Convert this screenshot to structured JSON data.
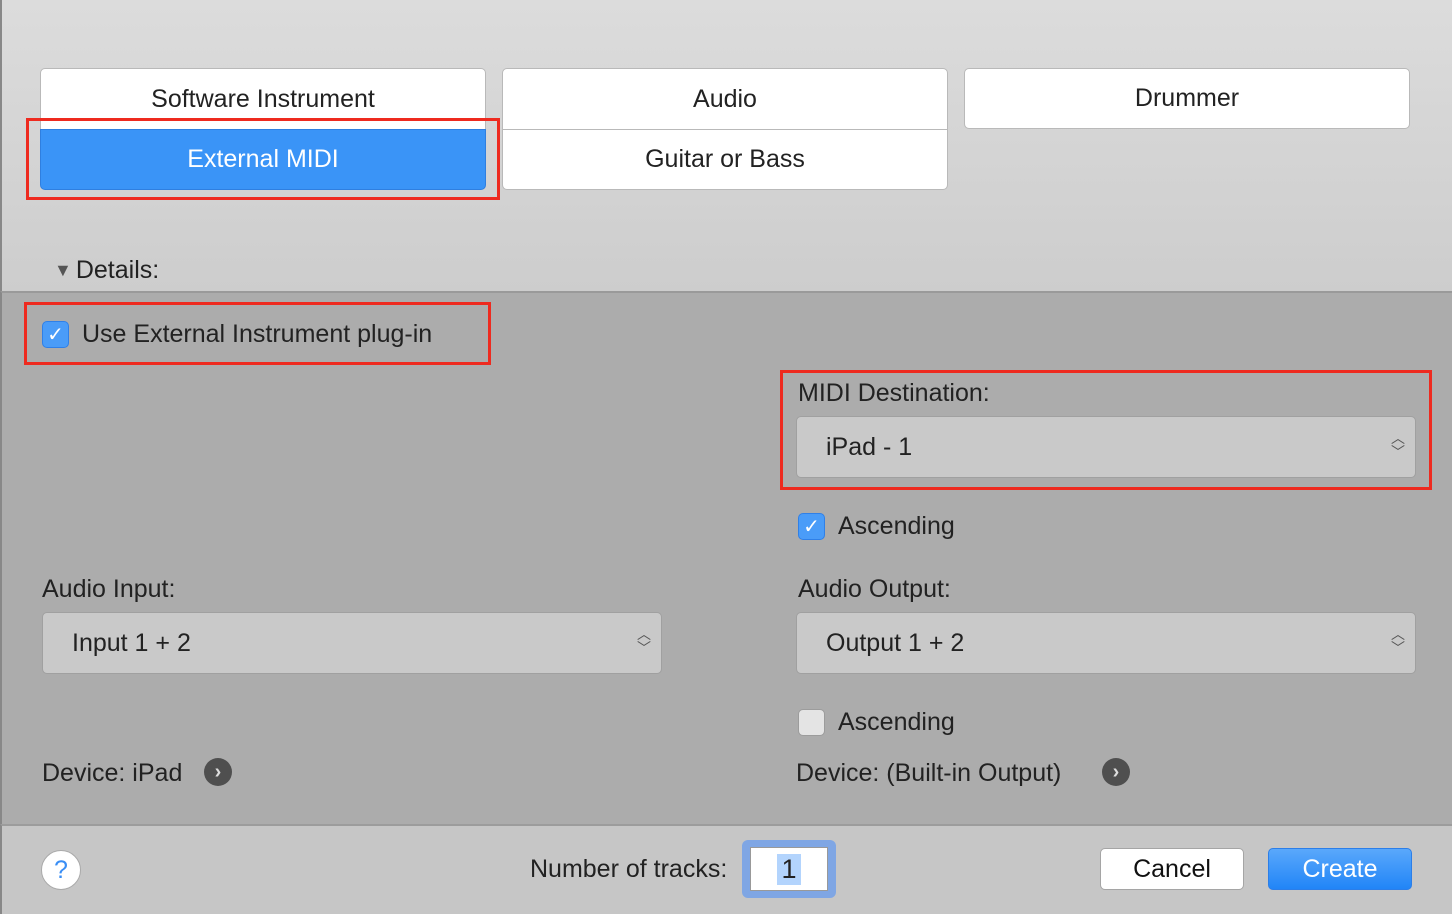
{
  "track_types": {
    "software_instrument": "Software Instrument",
    "audio": "Audio",
    "drummer": "Drummer",
    "external_midi": "External MIDI",
    "guitar_or_bass": "Guitar or Bass",
    "selected": "External MIDI"
  },
  "details": {
    "label": "Details:",
    "use_external_label": "Use External Instrument plug-in",
    "use_external_checked": true,
    "midi_destination_label": "MIDI Destination:",
    "midi_destination_value": "iPad - 1",
    "ascending1_label": "Ascending",
    "ascending1_checked": true,
    "audio_input_label": "Audio Input:",
    "audio_input_value": "Input 1 + 2",
    "audio_output_label": "Audio Output:",
    "audio_output_value": "Output 1 + 2",
    "ascending2_label": "Ascending",
    "ascending2_checked": false,
    "device_in": "Device: iPad",
    "device_out": "Device: (Built-in Output)"
  },
  "footer": {
    "help": "?",
    "tracks_label": "Number of tracks:",
    "tracks_value": "1",
    "cancel": "Cancel",
    "create": "Create"
  },
  "colors": {
    "accent": "#3a94f7",
    "highlight": "#ee2a1f"
  }
}
